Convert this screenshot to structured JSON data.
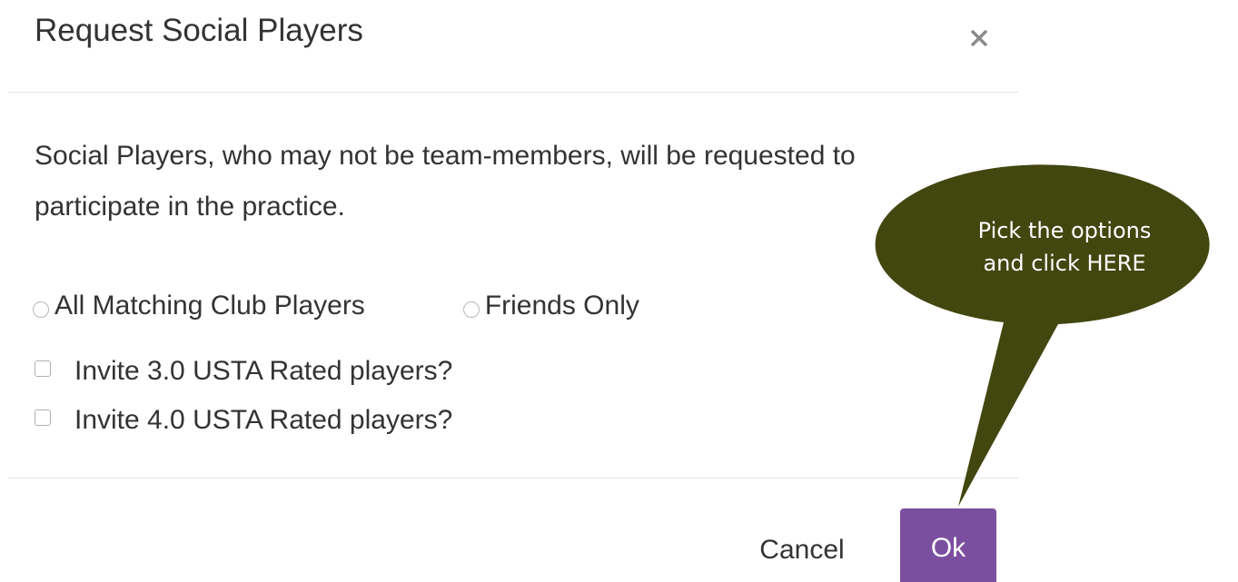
{
  "modal": {
    "title": "Request Social Players",
    "close_symbol": "×",
    "description": "Social Players, who may not be team-members, will be requested to participate in the practice."
  },
  "options": {
    "radios": [
      {
        "label": "All Matching Club Players",
        "checked": false
      },
      {
        "label": "Friends Only",
        "checked": false
      }
    ],
    "checkboxes": [
      {
        "label": "Invite 3.0 USTA Rated players?",
        "checked": false
      },
      {
        "label": "Invite 4.0 USTA Rated players?",
        "checked": false
      }
    ]
  },
  "footer": {
    "cancel_label": "Cancel",
    "ok_label": "Ok"
  },
  "callout": {
    "line1": "Pick the options",
    "line2": "and click HERE"
  },
  "colors": {
    "ok_button": "#7b4fa0",
    "callout_fill": "#424710",
    "text": "#333333"
  },
  "icons": {
    "close": "close-icon"
  }
}
